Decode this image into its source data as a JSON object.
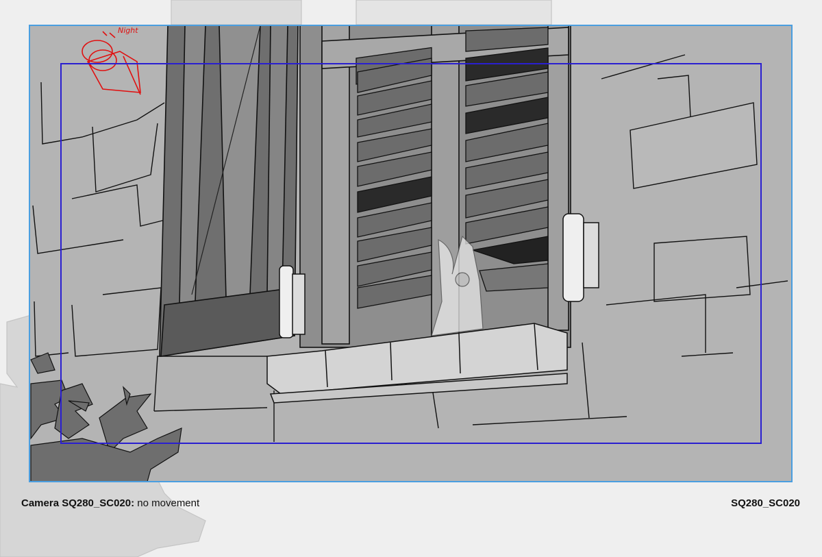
{
  "camera": {
    "label": "Camera SQ280_SC020:",
    "movement": "no movement"
  },
  "shot_code": "SQ280_SC020",
  "annotation": {
    "note": "Night",
    "color": "#e01010"
  },
  "frames": {
    "outer_color": "#4a9ee0",
    "inner_color": "#2a1fd0"
  }
}
